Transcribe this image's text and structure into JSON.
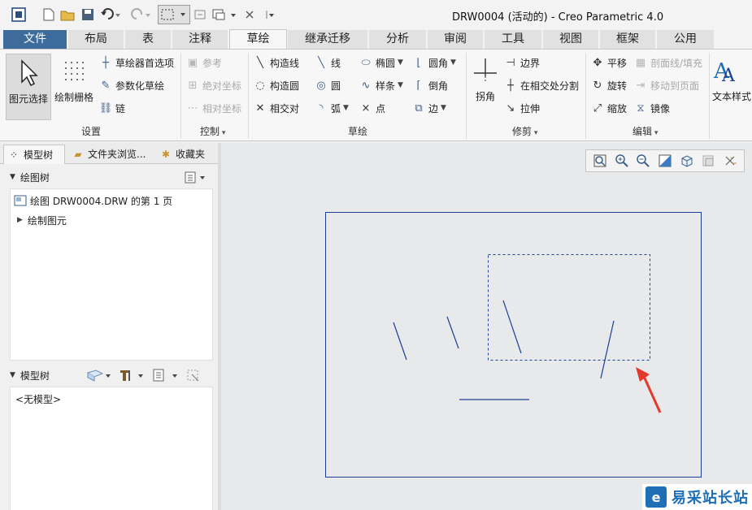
{
  "window": {
    "title": "DRW0004 (活动的) - Creo Parametric 4.0"
  },
  "tabs": [
    {
      "label": "文件"
    },
    {
      "label": "布局"
    },
    {
      "label": "表"
    },
    {
      "label": "注释"
    },
    {
      "label": "草绘"
    },
    {
      "label": "继承迁移"
    },
    {
      "label": "分析"
    },
    {
      "label": "审阅"
    },
    {
      "label": "工具"
    },
    {
      "label": "视图"
    },
    {
      "label": "框架"
    },
    {
      "label": "公用"
    }
  ],
  "ribbon": {
    "settings": {
      "label": "设置",
      "select": "图元选择",
      "grid": "绘制栅格",
      "prefs": "草绘器首选项",
      "param_sketch": "参数化草绘",
      "chain": "链"
    },
    "control": {
      "label": "控制",
      "reference": "参考",
      "abs_coord": "绝对坐标",
      "rel_coord": "相对坐标"
    },
    "sketch": {
      "label": "草绘",
      "construction_line": "构造线",
      "construction_circle": "构造圆",
      "intersection": "相交对",
      "line": "线",
      "circle": "圆",
      "arc": "弧",
      "ellipse": "椭圆",
      "spline": "样条",
      "point": "点",
      "fillet": "圆角",
      "chamfer": "倒角",
      "edge": "边"
    },
    "trim": {
      "label": "修剪",
      "corner": "拐角",
      "boundary": "边界",
      "split_at_intersection": "在相交处分割",
      "stretch": "拉伸"
    },
    "edit": {
      "label": "编辑",
      "translate": "平移",
      "rotate": "旋转",
      "scale": "缩放",
      "hatch": "剖面线/填充",
      "move_to_page": "移动到页面",
      "mirror": "镜像"
    },
    "format": {
      "text_style": "文本样式"
    }
  },
  "left_panel": {
    "tabs": [
      {
        "label": "模型树"
      },
      {
        "label": "文件夹浏览..."
      },
      {
        "label": "收藏夹"
      }
    ],
    "drawing_tree": {
      "header": "绘图树",
      "items": [
        {
          "label": "绘图 DRW0004.DRW 的第 1 页"
        },
        {
          "label": "绘制图元"
        }
      ]
    },
    "model_tree": {
      "header": "模型树",
      "empty_text": "<无模型>"
    }
  },
  "watermark": {
    "text": "易采站长站"
  },
  "colors": {
    "file_tab": "#3d6b9b",
    "sketch_line": "#1c3f94",
    "arrow": "#e33a2c",
    "canvas": "#e8e9eb"
  }
}
